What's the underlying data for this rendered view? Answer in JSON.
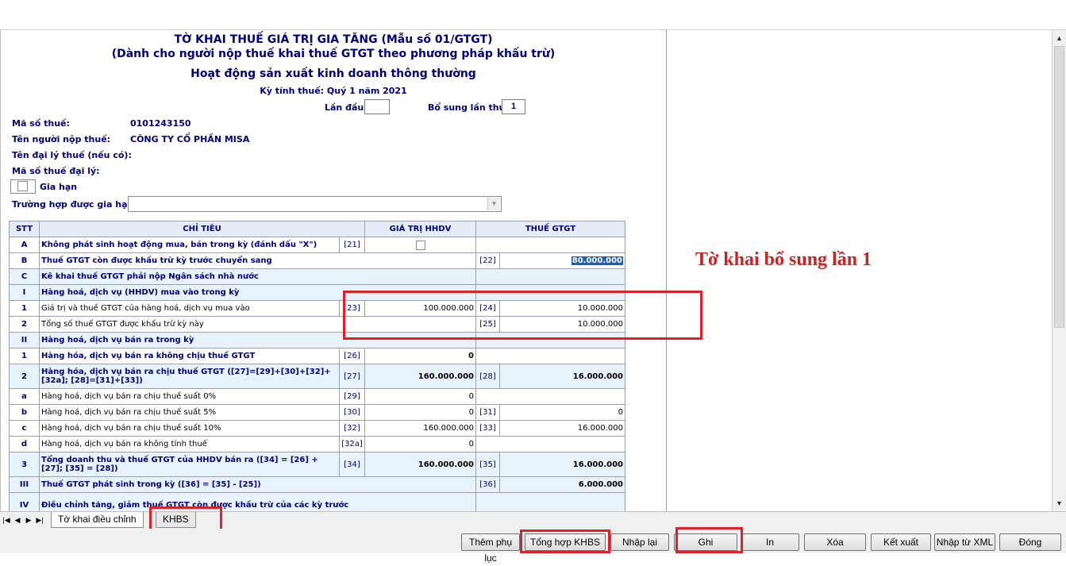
{
  "form": {
    "title1": "TỜ KHAI THUẾ GIÁ TRỊ GIA TĂNG (Mẫu số 01/GTGT)",
    "title2": "(Dành cho người nộp thuế khai thuế GTGT theo phương pháp khấu trừ)",
    "title3": "Hoạt động sản xuất kinh doanh thông thường",
    "period": "Kỳ tính thuế: Quý 1 năm 2021",
    "first_time_label": "Lần đầu:",
    "first_time_value": "",
    "supplement_label": "Bổ sung lần thứ:",
    "supplement_value": "1",
    "tax_code_label": "Mã số thuế:",
    "tax_code_value": "0101243150",
    "taxpayer_label": "Tên người nộp thuế:",
    "taxpayer_value": "CÔNG TY CỔ PHẦN MISA",
    "agent_label": "Tên đại lý thuế (nếu có):",
    "agent_code_label": "Mã số thuế đại lý:",
    "extension_label": "Gia hạn",
    "extension_case_label": "Trường hợp được gia hạn:",
    "extension_case_value": ""
  },
  "table": {
    "headers": [
      "STT",
      "CHỈ TIÊU",
      "GIÁ TRỊ HHDV",
      "THUẾ GTGT"
    ],
    "rows": [
      {
        "stt": "A",
        "desc": "Không phát sinh hoạt động mua, bán trong kỳ (đánh dấu \"X\")",
        "code1": "[21]",
        "val1": "",
        "code2": "",
        "val2": "",
        "bold": true,
        "blue": false
      },
      {
        "stt": "B",
        "desc": "Thuế GTGT còn được khấu trừ kỳ trước chuyển sang",
        "code1": "",
        "val1": "",
        "code2": "[22]",
        "val2": "80.000.000",
        "bold": true,
        "blue": false
      },
      {
        "stt": "C",
        "desc": "Kê khai thuế GTGT phải nộp Ngân sách nhà nước",
        "code1": "",
        "val1": "",
        "code2": "",
        "val2": "",
        "bold": true,
        "blue": true
      },
      {
        "stt": "I",
        "desc": "Hàng hoá, dịch vụ (HHDV) mua vào trong kỳ",
        "code1": "",
        "val1": "",
        "code2": "",
        "val2": "",
        "bold": true,
        "blue": true
      },
      {
        "stt": "1",
        "desc": "Giá trị và thuế GTGT của hàng hoá, dịch vụ mua vào",
        "code1": "[23]",
        "val1": "100.000.000",
        "code2": "[24]",
        "val2": "10.000.000",
        "bold": false,
        "blue": false
      },
      {
        "stt": "2",
        "desc": "Tổng số thuế GTGT được khấu trừ kỳ này",
        "code1": "",
        "val1": "",
        "code2": "[25]",
        "val2": "10.000.000",
        "bold": false,
        "blue": false
      },
      {
        "stt": "II",
        "desc": "Hàng hoá, dịch vụ bán ra trong kỳ",
        "code1": "",
        "val1": "",
        "code2": "",
        "val2": "",
        "bold": true,
        "blue": true
      },
      {
        "stt": "1",
        "desc": "Hàng hóa, dịch vụ bán ra không chịu thuế GTGT",
        "code1": "[26]",
        "val1": "0",
        "code2": "",
        "val2": "",
        "bold": true,
        "blue": false
      },
      {
        "stt": "2",
        "desc": "Hàng hóa, dịch vụ bán ra chịu thuế GTGT ([27]=[29]+[30]+[32]+[32a]; [28]=[31]+[33])",
        "code1": "[27]",
        "val1": "160.000.000",
        "code2": "[28]",
        "val2": "16.000.000",
        "bold": true,
        "blue": true
      },
      {
        "stt": "a",
        "desc": "Hàng hoá, dịch vụ bán ra chịu thuế suất 0%",
        "code1": "[29]",
        "val1": "0",
        "code2": "",
        "val2": "",
        "bold": false,
        "blue": false
      },
      {
        "stt": "b",
        "desc": "Hàng hoá, dịch vụ bán ra chịu thuế suất 5%",
        "code1": "[30]",
        "val1": "0",
        "code2": "[31]",
        "val2": "0",
        "bold": false,
        "blue": false
      },
      {
        "stt": "c",
        "desc": "Hàng hoá, dịch vụ bán ra chịu thuế suất 10%",
        "code1": "[32]",
        "val1": "160.000.000",
        "code2": "[33]",
        "val2": "16.000.000",
        "bold": false,
        "blue": false
      },
      {
        "stt": "d",
        "desc": "Hàng hoá, dịch vụ bán ra không tính thuế",
        "code1": "[32a]",
        "val1": "0",
        "code2": "",
        "val2": "",
        "bold": false,
        "blue": false
      },
      {
        "stt": "3",
        "desc": "Tổng doanh thu và thuế GTGT của HHDV bán ra ([34] = [26] + [27]; [35] = [28])",
        "code1": "[34]",
        "val1": "160.000.000",
        "code2": "[35]",
        "val2": "16.000.000",
        "bold": true,
        "blue": true
      },
      {
        "stt": "III",
        "desc": "Thuế GTGT phát sinh trong kỳ ([36] = [35] - [25])",
        "code1": "",
        "val1": "",
        "code2": "[36]",
        "val2": "6.000.000",
        "bold": true,
        "blue": true
      },
      {
        "stt": "IV",
        "desc": "Điều chỉnh tăng, giảm thuế GTGT còn được khấu trừ của các kỳ trước",
        "code1": "",
        "val1": "",
        "code2": "",
        "val2": "",
        "bold": true,
        "blue": true
      }
    ]
  },
  "annotation": "Tờ khai bổ sung lần 1",
  "tabs": [
    "Tờ khai điều chỉnh",
    "KHBS"
  ],
  "buttons": [
    "Thêm phụ lục",
    "Tổng hợp KHBS",
    "Nhập lại",
    "Ghi",
    "In",
    "Xóa",
    "Kết xuất",
    "Nhập từ XML",
    "Đóng"
  ]
}
